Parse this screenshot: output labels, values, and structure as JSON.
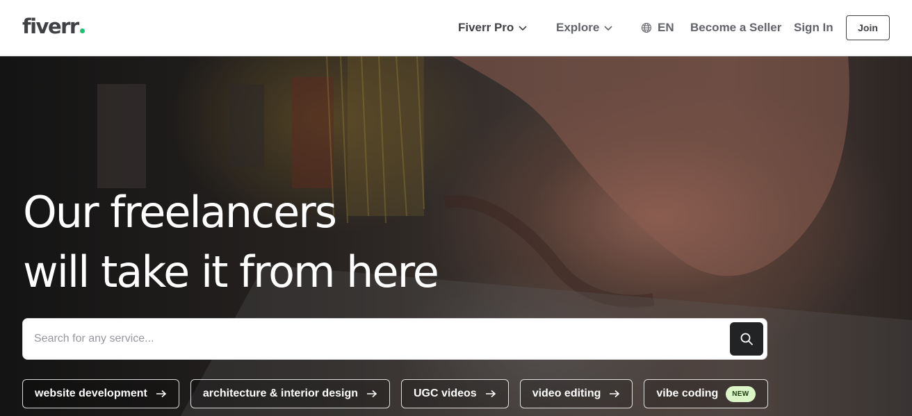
{
  "header": {
    "logo_text": "fiverr",
    "nav": {
      "pro_label": "Fiverr Pro",
      "explore_label": "Explore",
      "language_label": "EN",
      "become_seller_label": "Become a Seller",
      "sign_in_label": "Sign In",
      "join_label": "Join"
    }
  },
  "hero": {
    "title_line1": "Our freelancers",
    "title_line2": "will take it from here",
    "search": {
      "placeholder": "Search for any service..."
    },
    "chips": [
      {
        "label": "website development",
        "icon": "arrow-right-icon"
      },
      {
        "label": "architecture & interior design",
        "icon": "arrow-right-icon"
      },
      {
        "label": "UGC videos",
        "icon": "arrow-right-icon"
      },
      {
        "label": "video editing",
        "icon": "arrow-right-icon"
      },
      {
        "label": "vibe coding",
        "badge": "NEW"
      }
    ]
  },
  "colors": {
    "brand_green": "#1dbf73",
    "text_dark": "#404145",
    "text_muted": "#62646a",
    "search_button": "#222325",
    "badge_bg": "#dcf5c6"
  }
}
